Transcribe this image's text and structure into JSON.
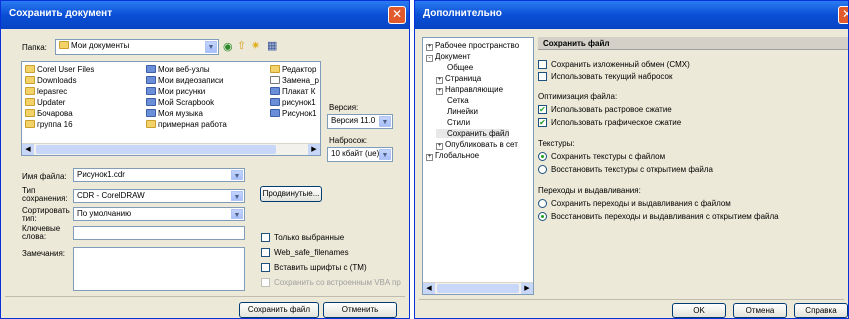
{
  "save_dialog": {
    "title": "Сохранить документ",
    "folder_label": "Папка:",
    "folder_value": "Мои документы",
    "files": [
      {
        "name": "Corel User Files",
        "icon": "folder"
      },
      {
        "name": "Downloads",
        "icon": "folder"
      },
      {
        "name": "lepasrec",
        "icon": "folder"
      },
      {
        "name": "Updater",
        "icon": "folder"
      },
      {
        "name": "Бочарова",
        "icon": "folder"
      },
      {
        "name": "группа 16",
        "icon": "folder"
      },
      {
        "name": "Мои веб-узлы",
        "icon": "special"
      },
      {
        "name": "Мои видеозаписи",
        "icon": "special"
      },
      {
        "name": "Мои рисунки",
        "icon": "special"
      },
      {
        "name": "Мой Scrapbook",
        "icon": "special"
      },
      {
        "name": "Моя музыка",
        "icon": "special"
      },
      {
        "name": "примерная работа",
        "icon": "folder"
      },
      {
        "name": "Редактор",
        "icon": "folder"
      },
      {
        "name": "Замена_р",
        "icon": "doc"
      },
      {
        "name": "Плакат К",
        "icon": "special"
      },
      {
        "name": "рисунок1",
        "icon": "special"
      },
      {
        "name": "Рисунок1",
        "icon": "special"
      }
    ],
    "version_label": "Версия:",
    "version_value": "Версия 11.0",
    "thumbnail_label": "Набросок:",
    "thumbnail_value": "10 кбайт (ue)",
    "filename_label": "Имя файла:",
    "filename_value": "Рисунок1.cdr",
    "type_label": "Тип сохранения:",
    "type_value": "CDR - CorelDRAW",
    "sort_label": "Сортировать тип:",
    "sort_value": "По умолчанию",
    "keywords_label": "Ключевые слова:",
    "notes_label": "Замечания:",
    "advanced_button": "Продвинутые...",
    "only_selected": "Только выбранные",
    "web_safe": "Web_safe_filenames",
    "embed_fonts": "Вставить шрифты с (TM)",
    "save_vba": "Сохранить со встроенным VBA пр",
    "save_button": "Сохранить файл",
    "cancel_button": "Отменить"
  },
  "options_dialog": {
    "title": "Дополнительно",
    "tree": [
      {
        "label": "Рабочее пространство",
        "level": 0,
        "toggle": "+"
      },
      {
        "label": "Документ",
        "level": 0,
        "toggle": "-"
      },
      {
        "label": "Общее",
        "level": 1,
        "toggle": ""
      },
      {
        "label": "Страница",
        "level": 1,
        "toggle": "+"
      },
      {
        "label": "Направляющие",
        "level": 1,
        "toggle": "+"
      },
      {
        "label": "Сетка",
        "level": 1,
        "toggle": ""
      },
      {
        "label": "Линейки",
        "level": 1,
        "toggle": ""
      },
      {
        "label": "Стили",
        "level": 1,
        "toggle": ""
      },
      {
        "label": "Сохранить файл",
        "level": 1,
        "toggle": ""
      },
      {
        "label": "Опубликовать в сет",
        "level": 1,
        "toggle": "+"
      },
      {
        "label": "Глобальное",
        "level": 0,
        "toggle": "+"
      }
    ],
    "panel_title": "Сохранить файл",
    "save_cmx": "Сохранить изложенный обмен (CMX)",
    "use_thumbnail": "Использовать текущий набросок",
    "optimization_label": "Оптимизация файла:",
    "raster_compression": "Использовать растровое сжатие",
    "graphic_compression": "Использовать графическое сжатие",
    "textures_label": "Текстуры:",
    "tex_save": "Сохранить текстуры с файлом",
    "tex_restore": "Восстановить текстуры с открытием файла",
    "blends_label": "Переходы и выдавливания:",
    "blend_save": "Сохранить переходы и выдавливания с файлом",
    "blend_restore": "Восстановить переходы и выдавливания с открытием файла",
    "ok_button": "OK",
    "cancel_button": "Отмена",
    "help_button": "Справка"
  }
}
